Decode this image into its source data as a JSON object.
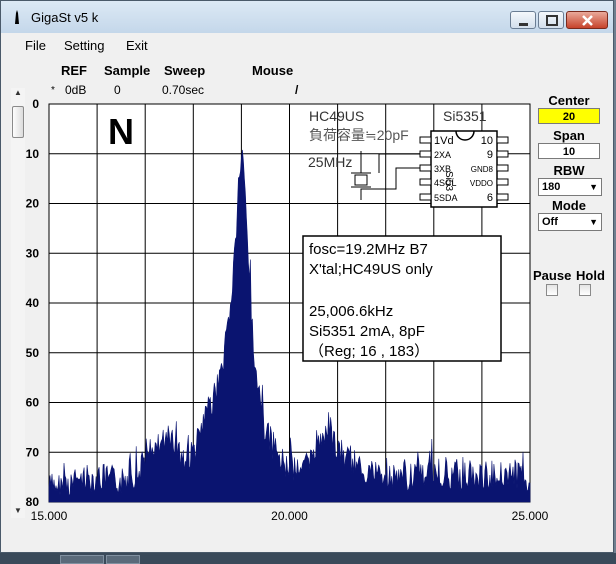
{
  "window": {
    "title": "GigaSt v5 k"
  },
  "menu": [
    "File",
    "Setting",
    "Exit"
  ],
  "header": {
    "ref_label": "REF",
    "ref_value": "0dB",
    "ref_marker": "*",
    "sample_label": "Sample",
    "sample_value": "0",
    "sweep_label": "Sweep",
    "sweep_value": "0.70sec",
    "mouse_label": "Mouse",
    "mouse_value": "/"
  },
  "side": {
    "center_label": "Center",
    "center_value": "20",
    "span_label": "Span",
    "span_value": "10",
    "rbw_label": "RBW",
    "rbw_value": "180",
    "mode_label": "Mode",
    "mode_value": "Off",
    "pause_label": "Pause",
    "hold_label": "Hold"
  },
  "overlay": {
    "mode_letter": "N",
    "crystal": "HC49US",
    "chip": "Si5351",
    "load_cap": "負荷容量≒20pF",
    "xtal_freq": "25MHz",
    "pins_left": [
      "1Vd",
      "2XA",
      "3XB",
      "4SCL",
      "5SDA"
    ],
    "pins_right": [
      "10",
      "9",
      "GND8",
      "VDDO",
      "6"
    ],
    "chip_marking": "Si53",
    "info_lines": [
      "fosc=19.2MHz B7",
      "X'tal;HC49US only",
      "",
      "25,006.6kHz",
      "Si5351 2mA, 8pF",
      "（Reg;  16 , 183）"
    ]
  },
  "colors": {
    "trace": "#0a1470",
    "center_box": "#ffff00"
  },
  "chart_data": {
    "type": "area",
    "title": "",
    "xlabel": "",
    "ylabel": "",
    "x_ticks": [
      "15.000",
      "20.000",
      "25.000"
    ],
    "y_ticks": [
      "0",
      "10",
      "20",
      "30",
      "40",
      "50",
      "60",
      "70",
      "80"
    ],
    "xlim": [
      15.0,
      25.0
    ],
    "ylim": [
      0,
      80
    ],
    "y_inverted": true,
    "grid": true,
    "series": [
      {
        "x": [
          15.0,
          15.5,
          16.0,
          16.5,
          17.0,
          17.5,
          17.8,
          18.0,
          18.2,
          18.4,
          18.6,
          18.8,
          18.9,
          18.95,
          19.0,
          19.05,
          19.1,
          19.2,
          19.3,
          19.5,
          19.8,
          20.0,
          20.5,
          20.8,
          21.0,
          21.5,
          22.0,
          22.5,
          23.0,
          23.5,
          24.0,
          24.5,
          25.0
        ],
        "y": [
          77,
          76,
          75,
          76,
          73,
          66,
          72,
          70,
          65,
          60,
          53,
          38,
          24,
          14,
          11,
          13,
          22,
          40,
          55,
          66,
          71,
          73,
          72,
          64,
          70,
          73,
          75,
          75,
          74,
          75,
          75,
          74,
          75
        ]
      }
    ]
  }
}
